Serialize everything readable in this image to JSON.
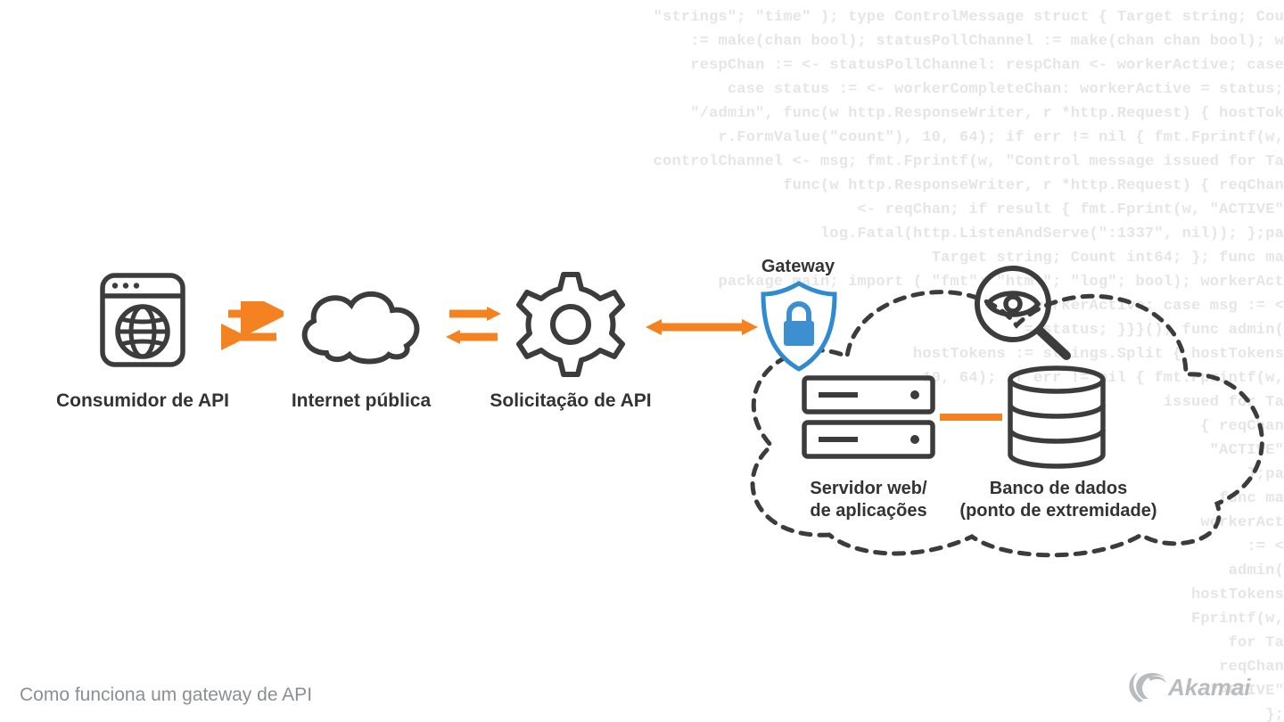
{
  "labels": {
    "consumer": "Consumidor de API",
    "internet": "Internet pública",
    "request": "Solicitação de API",
    "gateway": "Gateway",
    "webserver_l1": "Servidor web/",
    "webserver_l2": "de aplicações",
    "database_l1": "Banco de dados",
    "database_l2": "(ponto de extremidade)"
  },
  "caption": "Como funciona um gateway de API",
  "brand": "Akamai",
  "colors": {
    "stroke": "#3c3c3c",
    "orange": "#f58220",
    "blue_stroke": "#2f8ad0",
    "blue_fill": "#3d8fcf"
  },
  "bg_code": "\"strings\"; \"time\" ); type ControlMessage struct { Target string; Cou\n:= make(chan bool); statusPollChannel := make(chan chan bool); w\nrespChan := <- statusPollChannel: respChan <- workerActive; case\ncase status := <- workerCompleteChan: workerActive = status;\n\"/admin\", func(w http.ResponseWriter, r *http.Request) { hostTok\nr.FormValue(\"count\"), 10, 64); if err != nil { fmt.Fprintf(w,\ncontrolChannel <- msg; fmt.Fprintf(w, \"Control message issued for Ta\nfunc(w http.ResponseWriter, r *http.Request) { reqChan\n<- reqChan; if result { fmt.Fprint(w, \"ACTIVE\"\nlog.Fatal(http.ListenAndServe(\":1337\", nil)); };pa\nTarget string; Count int64; }; func ma\npackage main; import ( \"fmt\"; \"html\"; \"log\"; bool); workerAct\nworkerActive; case msg := <\n= status; }}}(); func admin(\nhostTokens := strings.Split { hostTokens\n10, 64); if err != nil { fmt.Fprintf(w,\nissued for Ta\n{ reqChan\n\"ACTIVE\"\n};pa\nfunc ma\nworkerAct\n:= <\nadmin(\nhostTokens\nFprintf(w,\nfor Ta\nreqChan\n\"ACTIVE\"\n};\n"
}
